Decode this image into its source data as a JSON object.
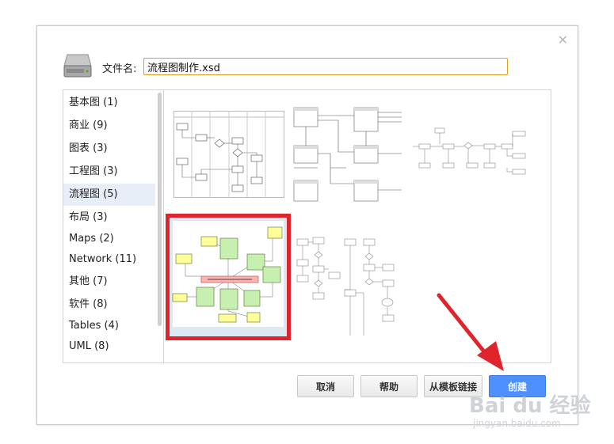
{
  "dialog": {
    "close_icon": "close-icon",
    "filename_label": "文件名:",
    "filename_value": "流程图制作.xsd"
  },
  "categories": [
    {
      "label": "基本图 (1)",
      "selected": false
    },
    {
      "label": "商业 (9)",
      "selected": false
    },
    {
      "label": "图表 (3)",
      "selected": false
    },
    {
      "label": "工程图 (3)",
      "selected": false
    },
    {
      "label": "流程图 (5)",
      "selected": true
    },
    {
      "label": "布局 (3)",
      "selected": false
    },
    {
      "label": "Maps (2)",
      "selected": false
    },
    {
      "label": "Network (11)",
      "selected": false
    },
    {
      "label": "其他 (7)",
      "selected": false
    },
    {
      "label": "软件 (8)",
      "selected": false
    },
    {
      "label": "Tables (4)",
      "selected": false
    },
    {
      "label": "UML (8)",
      "selected": false
    }
  ],
  "buttons": {
    "cancel": "取消",
    "help": "帮助",
    "from_template_link": "从模板链接",
    "create": "创建"
  },
  "colors": {
    "accent": "#4d90fe",
    "highlight": "#e0242b",
    "input_border": "#e0a020"
  },
  "watermark": {
    "logo": "Bai du 经验",
    "sub": "jingyan.baidu.com"
  }
}
